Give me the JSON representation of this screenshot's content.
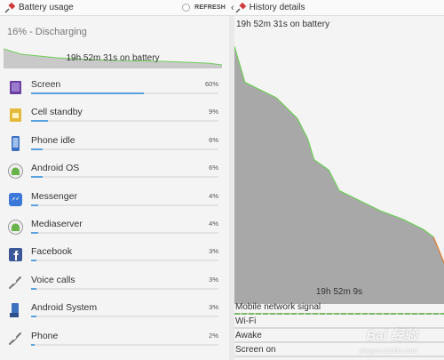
{
  "header_left": {
    "title": "Battery usage",
    "refresh_label": "REFRESH"
  },
  "header_right": {
    "title": "History details"
  },
  "status_text": "16% - Discharging",
  "summary_label": "19h 52m 31s on battery",
  "items": [
    {
      "name": "Screen",
      "percent": "60%",
      "level": 0.6,
      "icon": "screen-icon",
      "color": "#6b3fa0"
    },
    {
      "name": "Cell standby",
      "percent": "9%",
      "level": 0.09,
      "icon": "sim-card-icon",
      "color": "#e4b93a"
    },
    {
      "name": "Phone idle",
      "percent": "6%",
      "level": 0.06,
      "icon": "phone-icon",
      "color": "#3b6fc0"
    },
    {
      "name": "Android OS",
      "percent": "6%",
      "level": 0.06,
      "icon": "android-icon",
      "color": "#6ab24a"
    },
    {
      "name": "Messenger",
      "percent": "4%",
      "level": 0.04,
      "icon": "messenger-icon",
      "color": "#3b78d8"
    },
    {
      "name": "Mediaserver",
      "percent": "4%",
      "level": 0.04,
      "icon": "android-icon",
      "color": "#6ab24a"
    },
    {
      "name": "Facebook",
      "percent": "3%",
      "level": 0.03,
      "icon": "facebook-icon",
      "color": "#3b5998"
    },
    {
      "name": "Voice calls",
      "percent": "3%",
      "level": 0.03,
      "icon": "handset-icon",
      "color": "#777777"
    },
    {
      "name": "Android System",
      "percent": "3%",
      "level": 0.03,
      "icon": "system-icon",
      "color": "#3b6fc0"
    },
    {
      "name": "Phone",
      "percent": "2%",
      "level": 0.02,
      "icon": "handset-icon",
      "color": "#777777"
    }
  ],
  "history": {
    "title": "19h 52m 31s on battery",
    "axis_label": "19h 52m 9s",
    "signals": [
      {
        "name": "Mobile network signal",
        "bar": true
      },
      {
        "name": "Wi-Fi",
        "bar": false
      },
      {
        "name": "Awake",
        "bar": false
      },
      {
        "name": "Screen on",
        "bar": false
      }
    ]
  },
  "chart_data": {
    "type": "area",
    "title": "",
    "xlabel": "",
    "ylabel": "",
    "x": [
      0,
      0.05,
      0.1,
      0.2,
      0.3,
      0.35,
      0.38,
      0.45,
      0.5,
      0.6,
      0.7,
      0.8,
      0.9,
      0.95,
      1.0
    ],
    "y": [
      100,
      86,
      84,
      80,
      72,
      64,
      56,
      52,
      44,
      40,
      36,
      33,
      29,
      26,
      16
    ],
    "ylim": [
      0,
      100
    ],
    "colors": {
      "fill": "#a8a8a8",
      "line": "#6fcf5a",
      "low": "#e07a2e"
    }
  },
  "watermark": {
    "text": "Bai 经验",
    "sub": "jingyan.baidu.com"
  }
}
